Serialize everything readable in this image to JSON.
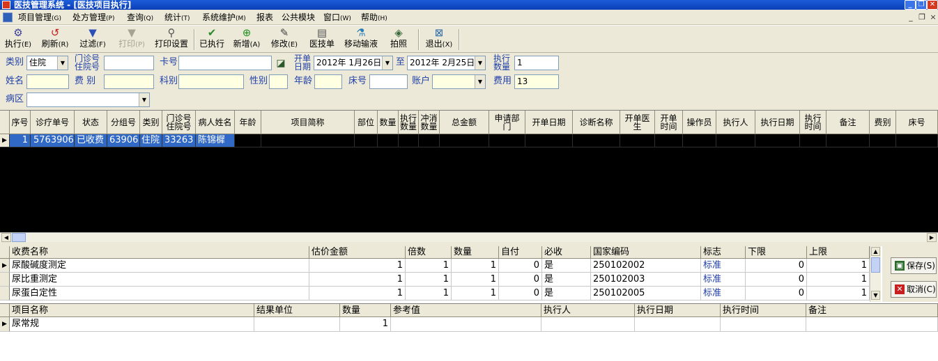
{
  "window": {
    "title": "医技管理系统 - [医技项目执行]"
  },
  "menu": [
    {
      "label": "项目管理",
      "key": "(G)"
    },
    {
      "label": "处方管理",
      "key": "(P)"
    },
    {
      "label": "查询",
      "key": "(Q)"
    },
    {
      "label": "统计",
      "key": "(T)"
    },
    {
      "label": "系统维护",
      "key": "(M)"
    },
    {
      "label": "报表",
      "key": ""
    },
    {
      "label": "公共模块",
      "key": ""
    },
    {
      "label": "窗口",
      "key": "(W)"
    },
    {
      "label": "帮助",
      "key": "(H)"
    }
  ],
  "toolbar": [
    {
      "label": "执行",
      "key": "(E)",
      "icon": "gear-icon"
    },
    {
      "label": "刷新",
      "key": "(R)",
      "icon": "refresh-icon"
    },
    {
      "label": "过滤",
      "key": "(F)",
      "icon": "filter-icon"
    },
    {
      "label": "打印",
      "key": "(P)",
      "icon": "print-icon"
    },
    {
      "label": "打印设置",
      "key": "",
      "icon": "print-settings-icon"
    },
    {
      "label": "已执行",
      "key": "",
      "icon": "executed-icon"
    },
    {
      "label": "新增",
      "key": "(A)",
      "icon": "add-icon"
    },
    {
      "label": "修改",
      "key": "(E)",
      "icon": "edit-icon"
    },
    {
      "label": "医技单",
      "key": "",
      "icon": "document-icon"
    },
    {
      "label": "移动输液",
      "key": "",
      "icon": "infusion-icon"
    },
    {
      "label": "拍照",
      "key": "",
      "icon": "camera-icon"
    },
    {
      "label": "退出",
      "key": "(X)",
      "icon": "exit-icon"
    }
  ],
  "form": {
    "category_label": "类别",
    "category_value": "住院",
    "clinic_no_label_1": "门诊号",
    "clinic_no_label_2": "住院号",
    "clinic_no_value": "",
    "card_label": "卡号",
    "card_value": "",
    "open_date_label_1": "开单",
    "open_date_label_2": "日期",
    "date_from": "2012年 1月26日",
    "date_to_label": "至",
    "date_to": "2012年 2月25日",
    "exec_qty_label_1": "执行",
    "exec_qty_label_2": "数量",
    "exec_qty_value": "1",
    "name_label": "姓名",
    "name_value": "",
    "fee_type_label": "费  别",
    "fee_type_value": "",
    "dept_label": "科别",
    "dept_value": "",
    "sex_label": "性别",
    "sex_value": "",
    "age_label": "年龄",
    "age_value": "",
    "bed_label": "床号",
    "bed_value": "",
    "account_label": "账户",
    "account_value": "",
    "fee_label": "费用",
    "fee_value": "13",
    "ward_label": "病区",
    "ward_value": ""
  },
  "orders": {
    "columns": [
      "序号",
      "诊疗单号",
      "状态",
      "分组号",
      "类别",
      "门诊号 住院号",
      "病人姓名",
      "年龄",
      "项目简称",
      "部位",
      "数量",
      "执行 数量",
      "冲消 数量",
      "总金额",
      "申请部 门",
      "开单日期",
      "诊断名称",
      "开单医 生",
      "开单 时间",
      "操作员",
      "执行人",
      "执行日期",
      "执行 时间",
      "备注",
      "费别",
      "床号"
    ],
    "rows": [
      [
        "1",
        "5763906",
        "已收费",
        "63906",
        "住院",
        "33263",
        "陈锦樨",
        "",
        "",
        "",
        "",
        "",
        "",
        "",
        "",
        "",
        "",
        "",
        "",
        "",
        "",
        "",
        "",
        "",
        "",
        ""
      ]
    ]
  },
  "charges": {
    "columns": [
      "收费名称",
      "估价金额",
      "倍数",
      "数量",
      "自付",
      "必收",
      "国家编码",
      "标志",
      "下限",
      "上限"
    ],
    "rows": [
      [
        "尿酸碱度测定",
        "1",
        "1",
        "1",
        "0",
        "是",
        "250102002",
        "标准",
        "0",
        "1"
      ],
      [
        "尿比重测定",
        "1",
        "1",
        "1",
        "0",
        "是",
        "250102003",
        "标准",
        "0",
        "1"
      ],
      [
        "尿蛋白定性",
        "1",
        "1",
        "1",
        "0",
        "是",
        "250102005",
        "标准",
        "0",
        "1"
      ]
    ]
  },
  "actions": {
    "save": "保存(S)",
    "cancel": "取消(C)"
  },
  "items": {
    "columns": [
      "项目名称",
      "结果单位",
      "数量",
      "参考值",
      "执行人",
      "执行日期",
      "执行时间",
      "备注"
    ],
    "rows": [
      [
        "尿常规",
        "",
        "1",
        "",
        "",
        "",
        "",
        ""
      ]
    ]
  },
  "colors": {
    "title_bar": "#0b3fb8",
    "label_blue": "#1f3fa8",
    "selection": "#3169c6",
    "grid_bg": "#000000",
    "highlight_input": "#ffffe1"
  }
}
